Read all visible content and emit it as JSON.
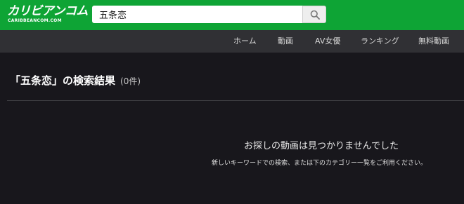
{
  "header": {
    "logo_text": "カリビアンコム",
    "logo_subtext": "CARIBBEANCOM.COM",
    "brand_color": "#0ea435"
  },
  "search": {
    "value": "五条恋",
    "icon": "search-icon"
  },
  "nav": {
    "items": [
      {
        "label": "ホーム"
      },
      {
        "label": "動画"
      },
      {
        "label": "AV女優"
      },
      {
        "label": "ランキング"
      },
      {
        "label": "無料動画"
      }
    ]
  },
  "results": {
    "title": "「五条恋」の検索結果",
    "count": "(0件)"
  },
  "empty_state": {
    "title": "お探しの動画は見つかりませんでした",
    "description": "新しいキーワードでの検索、または下のカテゴリー一覧をご利用ください。"
  }
}
